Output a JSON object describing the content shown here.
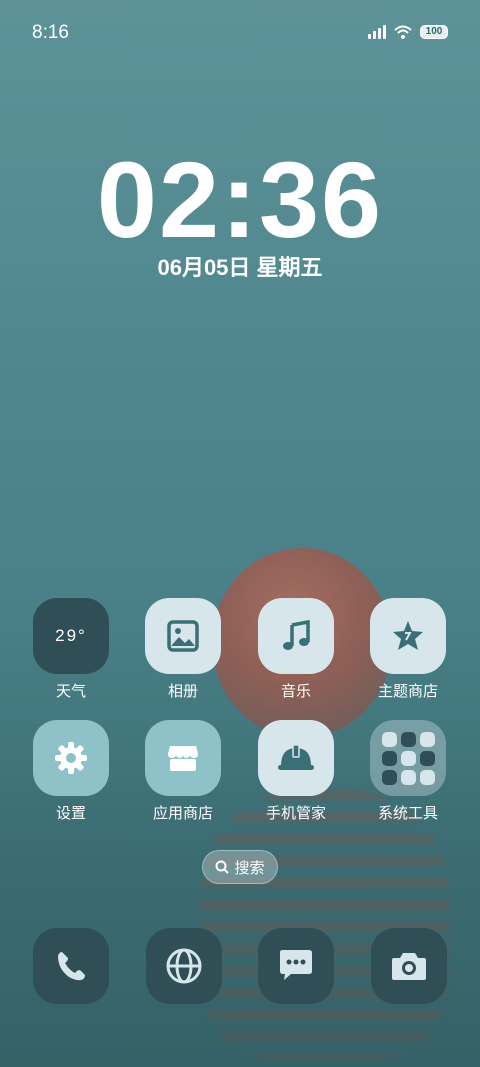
{
  "status_bar": {
    "time": "8:16",
    "battery": "100"
  },
  "lockscreen_clock": {
    "time": "02:36",
    "date": "06月05日 星期五"
  },
  "apps": {
    "weather": {
      "label": "天气",
      "temp": "29°"
    },
    "gallery": {
      "label": "相册"
    },
    "music": {
      "label": "音乐"
    },
    "theme_store": {
      "label": "主题商店"
    },
    "settings": {
      "label": "设置"
    },
    "app_store": {
      "label": "应用商店"
    },
    "security": {
      "label": "手机管家"
    },
    "tools_folder": {
      "label": "系统工具"
    }
  },
  "search": {
    "label": "搜索"
  },
  "dock": {
    "items": [
      {
        "icon": "phone-icon"
      },
      {
        "icon": "browser-icon"
      },
      {
        "icon": "messages-icon"
      },
      {
        "icon": "camera-icon"
      }
    ]
  },
  "colors": {
    "tile_light": "#d6e6ea",
    "tile_mid": "#8fc1c8",
    "tile_dark": "#2f4e55",
    "icon_accent": "#3b6f77"
  }
}
